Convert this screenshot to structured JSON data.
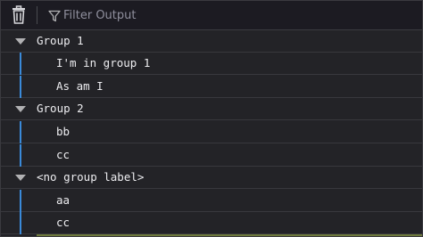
{
  "toolbar": {
    "clear_icon": "trash-icon",
    "filter_icon": "funnel-icon",
    "filter_placeholder": "Filter Output",
    "filter_value": ""
  },
  "groups": [
    {
      "label": "Group 1",
      "items": [
        "I'm in group 1",
        "As am I"
      ]
    },
    {
      "label": "Group 2",
      "items": [
        "bb",
        "cc"
      ]
    },
    {
      "label": "<no group label>",
      "items": [
        "aa",
        "cc"
      ]
    }
  ],
  "colors": {
    "background": "#232327",
    "toolbar": "#1c1b22",
    "group_indent_bar": "#3a8ad9",
    "text": "#ededf0",
    "placeholder": "#8f8f9d"
  }
}
